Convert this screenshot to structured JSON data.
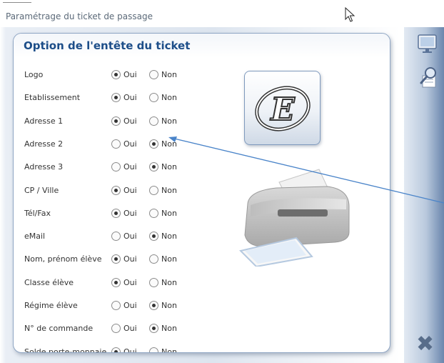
{
  "window": {
    "title": "Paramétrage du ticket de passage"
  },
  "panel": {
    "title": "Option de l'entête du ticket"
  },
  "options": {
    "oui_label": "Oui",
    "non_label": "Non",
    "rows": [
      {
        "label": "Logo",
        "selected": "oui"
      },
      {
        "label": "Etablissement",
        "selected": "oui"
      },
      {
        "label": "Adresse 1",
        "selected": "oui"
      },
      {
        "label": "Adresse 2",
        "selected": "non"
      },
      {
        "label": "Adresse 3",
        "selected": "non"
      },
      {
        "label": "CP / Ville",
        "selected": "oui"
      },
      {
        "label": "Tél/Fax",
        "selected": "oui"
      },
      {
        "label": "eMail",
        "selected": "non"
      },
      {
        "label": "Nom, prénom élève",
        "selected": "oui"
      },
      {
        "label": "Classe élève",
        "selected": "oui"
      },
      {
        "label": "Régime élève",
        "selected": "non"
      },
      {
        "label": "N° de commande",
        "selected": "non"
      },
      {
        "label": "Solde porte-monnaie",
        "selected": "oui"
      }
    ]
  },
  "logo": {
    "letter": "E"
  },
  "icons": {
    "monitor": "monitor-icon",
    "preview": "print-preview-icon",
    "close": "close-icon",
    "close_glyph": "✖"
  },
  "colors": {
    "accent": "#1d4e89",
    "annotation": "#4a84c9"
  }
}
